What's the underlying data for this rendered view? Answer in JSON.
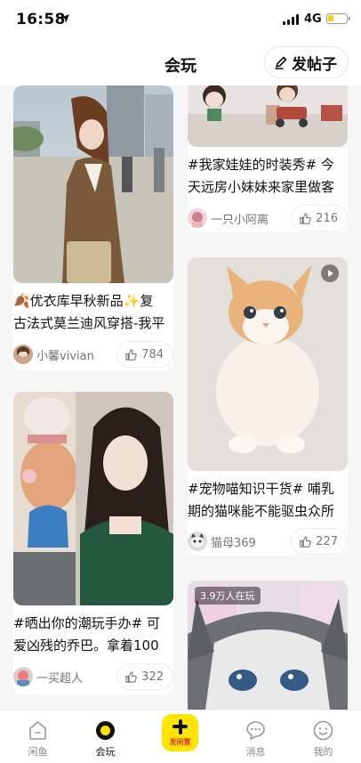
{
  "status_bar": {
    "time": "16:58",
    "network": "4G",
    "battery_level": 0.3,
    "battery_color": "#f5d600"
  },
  "header": {
    "title": "会玩",
    "post_button": "发帖子",
    "post_icon": "pen-icon"
  },
  "feed": {
    "left": [
      {
        "image": "photo-girl-street",
        "caption_lines": [
          "🍂优衣库早秋新品✨复",
          "古法式莫兰迪风穿搭-我平"
        ],
        "author": "小馨vivian",
        "likes": "784"
      },
      {
        "image": "photo-woman-with-figure",
        "caption_lines": [
          "#晒出你的潮玩手办# 可",
          "爱凶残的乔巴。拿着100"
        ],
        "author": "一买超人",
        "likes": "322"
      }
    ],
    "right": [
      {
        "image": "photo-dolls",
        "caption_lines": [
          "#我家娃娃的时装秀# 今",
          "天远房小妹妹来家里做客"
        ],
        "author": "一只小阿离",
        "likes": "216"
      },
      {
        "image": "photo-kitten",
        "video": true,
        "caption_lines": [
          "#宠物喵知识干货# 哺乳",
          "期的猫咪能不能驱虫众所"
        ],
        "author": "猫母369",
        "likes": "227"
      },
      {
        "image": "photo-cat-closeup",
        "badge": "3.9万人在玩"
      }
    ]
  },
  "tabbar": {
    "tabs": [
      {
        "label": "闲鱼",
        "icon": "home-icon"
      },
      {
        "label": "会玩",
        "icon": "play-circle-icon",
        "active": true
      },
      {
        "label": "发闲置",
        "icon": "plus-icon"
      },
      {
        "label": "消息",
        "icon": "chat-icon"
      },
      {
        "label": "我的",
        "icon": "smile-icon"
      }
    ]
  },
  "colors": {
    "accent": "#ffe400",
    "publish_label": "#e0322b",
    "like_icon": "#777777"
  }
}
